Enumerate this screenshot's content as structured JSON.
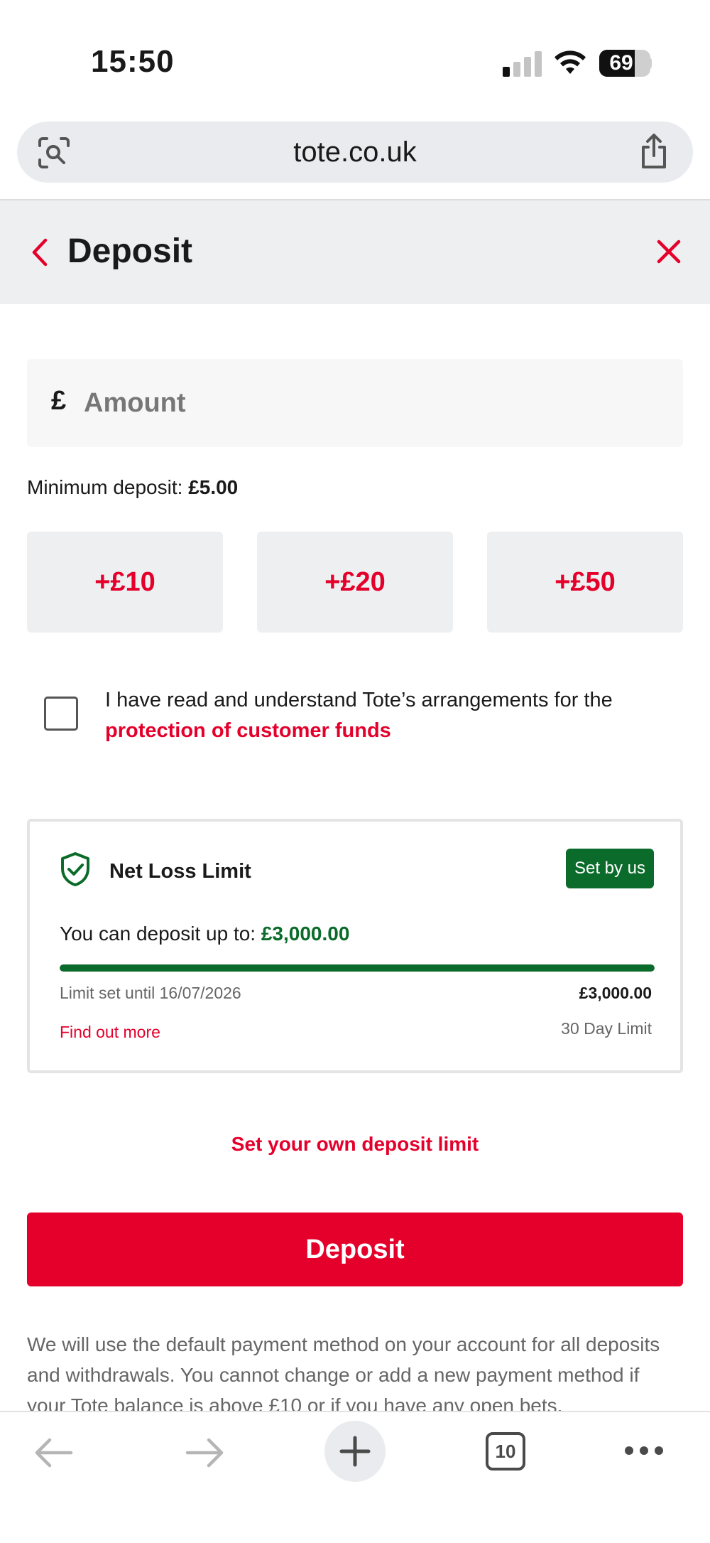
{
  "status_bar": {
    "time": "15:50",
    "battery": "69",
    "battery_level": 0.69
  },
  "browser": {
    "url": "tote.co.uk",
    "open_tabs": "10"
  },
  "header": {
    "title": "Deposit"
  },
  "amount": {
    "currency": "£",
    "placeholder": "Amount",
    "value": ""
  },
  "min_deposit": {
    "label": "Minimum deposit:",
    "value": "£5.00"
  },
  "quick_amounts": [
    "+£10",
    "+£20",
    "+£50"
  ],
  "consent": {
    "checked": false,
    "text": "I have read and understand Tote’s arrangements for the",
    "link": "protection of customer funds"
  },
  "limit_card": {
    "title": "Net Loss Limit",
    "badge": "Set by us",
    "deposit_label": "You can deposit up to:",
    "deposit_amount": "£3,000.00",
    "progress": 1.0,
    "until": "Limit set until 16/07/2026",
    "max": "£3,000.00",
    "find_out": "Find out more",
    "period": "30 Day Limit",
    "accent_color": "#0b6b2a"
  },
  "own_limit_link": "Set your own deposit limit",
  "deposit_button": "Deposit",
  "footer_note": "We will use the default payment method on your account for all deposits and withdrawals. You cannot change or add a new payment method if your Tote balance is above £10 or if you have any open bets.",
  "colors": {
    "brand_red": "#e4002b",
    "limit_green": "#0b6b2a"
  }
}
